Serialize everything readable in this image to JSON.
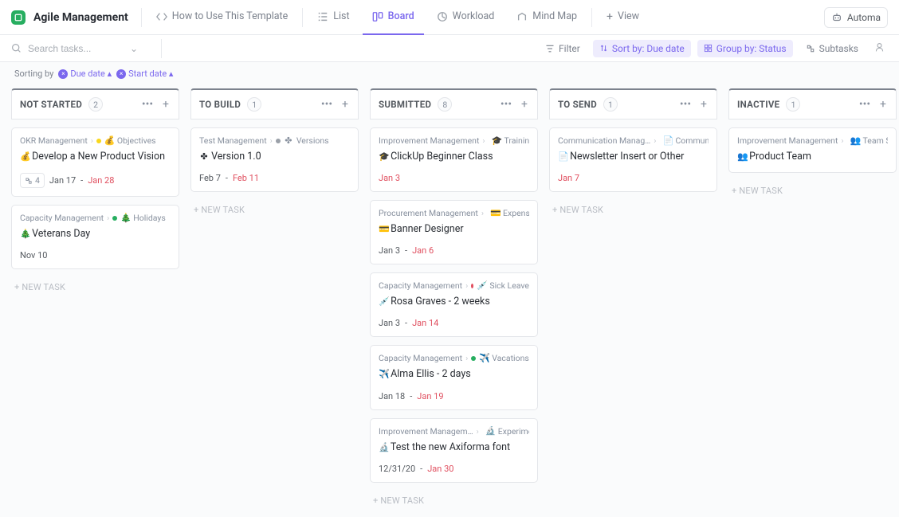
{
  "header": {
    "space_name": "Agile Management",
    "tabs": [
      {
        "icon": "code",
        "label": "How to Use This Template",
        "active": false
      },
      {
        "icon": "list",
        "label": "List",
        "active": false
      },
      {
        "icon": "board",
        "label": "Board",
        "active": true
      },
      {
        "icon": "workload",
        "label": "Workload",
        "active": false
      },
      {
        "icon": "mindmap",
        "label": "Mind Map",
        "active": false
      }
    ],
    "add_view": "View",
    "automate": "Automa"
  },
  "filterbar": {
    "search_placeholder": "Search tasks...",
    "filter_label": "Filter",
    "sort_label": "Sort by: Due date",
    "group_label": "Group by: Status",
    "subtasks_label": "Subtasks"
  },
  "sortline": {
    "prefix": "Sorting by",
    "chips": [
      "Due date ▴",
      "Start date ▴"
    ]
  },
  "columns": [
    {
      "key": "not_started",
      "name": "NOT STARTED",
      "count": "2",
      "cards": [
        {
          "crumb_list": "OKR Management",
          "crumb_dotcolor": "y",
          "crumb_emoji": "💰",
          "crumb_folder": "Objectives",
          "title_emoji": "💰",
          "title": "Develop a New Product Vision",
          "sub_count": "4",
          "date1": "Jan 17",
          "date2": "Jan 28"
        },
        {
          "crumb_list": "Capacity Management",
          "crumb_dotcolor": "g",
          "crumb_emoji": "🎄",
          "crumb_folder": "Holidays",
          "title_emoji": "🎄",
          "title": "Veterans Day",
          "date_single": "Nov 10"
        }
      ]
    },
    {
      "key": "to_build",
      "name": "TO BUILD",
      "count": "1",
      "cards": [
        {
          "crumb_list": "Test Management",
          "crumb_dotcolor": "gr",
          "crumb_emoji": "✤",
          "crumb_folder": "Versions",
          "title_emoji": "✤",
          "title": "Version 1.0",
          "date1": "Feb 7",
          "date2": "Feb 11"
        }
      ]
    },
    {
      "key": "submitted",
      "name": "SUBMITTED",
      "count": "8",
      "cards": [
        {
          "crumb_list": "Improvement Management",
          "crumb_dotcolor": "gr",
          "crumb_emoji": "🎓",
          "crumb_folder": "Trainings",
          "title_emoji": "🎓",
          "title": "ClickUp Beginner Class",
          "date2_only": "Jan 3"
        },
        {
          "crumb_list": "Procurement Management",
          "crumb_dotcolor": "or",
          "crumb_emoji": "💳",
          "crumb_folder": "Expenses",
          "title_emoji": "💳",
          "title": "Banner Designer",
          "date1": "Jan 3",
          "date2": "Jan 6"
        },
        {
          "crumb_list": "Capacity Management",
          "crumb_dotcolor": "r",
          "crumb_emoji": "💉",
          "crumb_folder": "Sick Leave",
          "title_emoji": "💉",
          "title": "Rosa Graves - 2 weeks",
          "date1": "Jan 3",
          "date2": "Jan 14"
        },
        {
          "crumb_list": "Capacity Management",
          "crumb_dotcolor": "g",
          "crumb_emoji": "✈️",
          "crumb_folder": "Vacations",
          "title_emoji": "✈️",
          "title": "Alma Ellis - 2 days",
          "date1": "Jan 18",
          "date2": "Jan 19"
        },
        {
          "crumb_list": "Improvement Managem…",
          "crumb_dotcolor": "g",
          "crumb_emoji": "🔬",
          "crumb_folder": "Experime…",
          "title_emoji": "🔬",
          "title": "Test the new Axiforma font",
          "date1": "12/31/20",
          "date2": "Jan 30"
        }
      ]
    },
    {
      "key": "to_send",
      "name": "TO SEND",
      "count": "1",
      "cards": [
        {
          "crumb_list": "Communication Manag…",
          "crumb_dotcolor": "gr",
          "crumb_emoji": "📄",
          "crumb_folder": "Communica…",
          "title_emoji": "📄",
          "title": "Newsletter Insert or Other",
          "date2_only": "Jan 7"
        }
      ]
    },
    {
      "key": "inactive",
      "name": "INACTIVE",
      "count": "1",
      "cards": [
        {
          "crumb_list": "Improvement Management",
          "crumb_dotcolor": "g",
          "crumb_emoji": "👥",
          "crumb_folder": "Team Status",
          "title_emoji": "👥",
          "title": "Product Team"
        }
      ]
    }
  ],
  "new_task_label": "+ NEW TASK"
}
